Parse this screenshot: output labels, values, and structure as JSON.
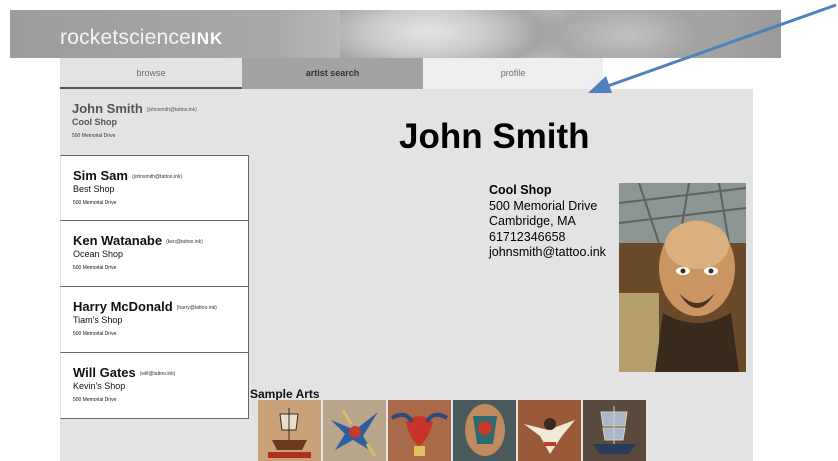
{
  "header": {
    "logo_thin": "rocketscience",
    "logo_bold": "INK"
  },
  "tabs": [
    {
      "label": "browse"
    },
    {
      "label": "artist search"
    },
    {
      "label": "profile"
    }
  ],
  "artists": [
    {
      "name": "John Smith",
      "email": "(johnsmith@tattoo.ink)",
      "shop": "Cool Shop",
      "address": "500 Memorial Drive"
    },
    {
      "name": "Sim Sam",
      "email": "(johnsmith@tattoo.ink)",
      "shop": "Best Shop",
      "address": "500 Memorial Drive"
    },
    {
      "name": "Ken Watanabe",
      "email": "(ken@tattoo.ink)",
      "shop": "Ocean Shop",
      "address": "500 Memorial Drive"
    },
    {
      "name": "Harry McDonald",
      "email": "(harry@tattoo.ink)",
      "shop": "Tiam's Shop",
      "address": "500 Memorial Drive"
    },
    {
      "name": "Will Gates",
      "email": "(will@tattoo.ink)",
      "shop": "Kevin's Shop",
      "address": "500 Memorial Drive"
    }
  ],
  "profile": {
    "name": "John Smith",
    "shop": "Cool Shop",
    "street": "500 Memorial Drive",
    "city": "Cambridge, MA",
    "phone": "61712346658",
    "email": "johnsmith@tattoo.ink"
  },
  "samples": {
    "title": "Sample Arts",
    "items": [
      "ship-tattoo",
      "swallow-tattoo",
      "chest-piece-tattoo",
      "arm-sleeve-tattoo",
      "eagle-tattoo",
      "clipper-ship-tattoo"
    ]
  },
  "colors": {
    "arrow": "#4f81bd",
    "panel": "#e3e3e3",
    "active_tab": "#a3a3a3"
  }
}
